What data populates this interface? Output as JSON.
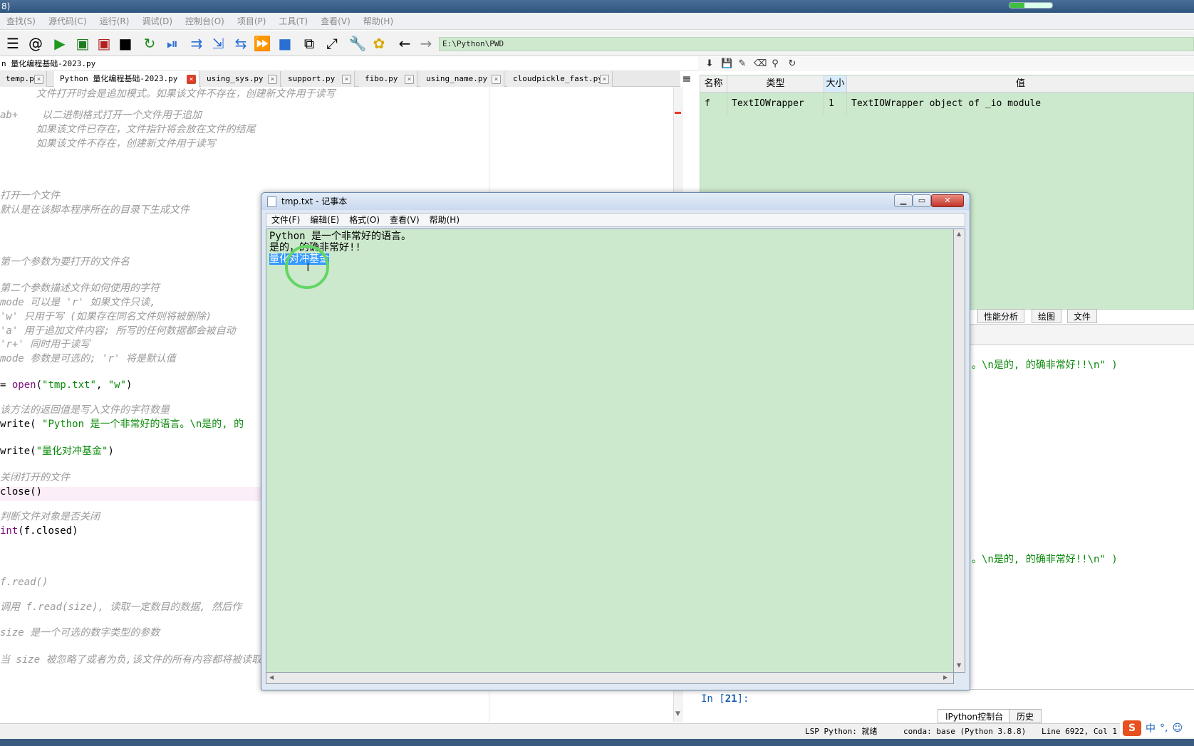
{
  "window": {
    "title_fragment": "8)"
  },
  "task_progress": 0.35,
  "menubar": [
    "查找(S)",
    "源代码(C)",
    "运行(R)",
    "调试(D)",
    "控制台(O)",
    "项目(P)",
    "工具(T)",
    "查看(V)",
    "帮助(H)"
  ],
  "toolbar": {
    "icons": [
      "outline-icon",
      "at-icon",
      "run-icon",
      "run-cell-icon",
      "run-cell-advance-icon",
      "run-selection-icon",
      "rerun-icon",
      "debug-icon",
      "step-icon",
      "step-into-icon",
      "step-return-icon",
      "continue-icon",
      "stop-icon",
      "maximize-pane-icon",
      "fullscreen-icon",
      "preferences-icon",
      "python-path-icon",
      "back-icon",
      "forward-icon"
    ],
    "path": "E:\\Python\\PWD"
  },
  "editor": {
    "file_title": "n 量化编程基础-2023.py",
    "tabs": [
      "temp.py",
      "Python 量化编程基础-2023.py",
      "using_sys.py",
      "support.py",
      "fibo.py",
      "using_name.py",
      "cloudpickle_fast.py"
    ],
    "active_tab": 1
  },
  "code_lines": [
    {
      "type": "cmt",
      "text": "      文件打开时会是追加模式。如果该文件不存在，创建新文件用于读写"
    },
    {
      "type": "cmt",
      "text": "ab+    以二进制格式打开一个文件用于追加"
    },
    {
      "type": "cmt",
      "text": "      如果该文件已存在，文件指针将会放在文件的结尾"
    },
    {
      "type": "cmt",
      "text": "      如果该文件不存在，创建新文件用于读写"
    },
    {
      "type": "cmt",
      "text": "打开一个文件"
    },
    {
      "type": "cmt",
      "text": "默认是在该脚本程序所在的目录下生成文件"
    },
    {
      "type": "cmt",
      "text": "第一个参数为要打开的文件名"
    },
    {
      "type": "cmt",
      "text": "第二个参数描述文件如何使用的字符"
    },
    {
      "type": "cmt",
      "text": "mode 可以是 'r' 如果文件只读,"
    },
    {
      "type": "cmt",
      "text": "'w' 只用于写 (如果存在同名文件则将被删除)"
    },
    {
      "type": "cmt",
      "text": "'a' 用于追加文件内容; 所写的任何数据都会被自动"
    },
    {
      "type": "cmt",
      "text": "'r+' 同时用于读写"
    },
    {
      "type": "cmt",
      "text": "mode 参数是可选的; 'r' 将是默认值"
    },
    {
      "type": "open",
      "pre": "= ",
      "fn": "open",
      "a": "(",
      "s1": "\"tmp.txt\"",
      "b": ", ",
      "s2": "\"w\"",
      "c": ")"
    },
    {
      "type": "cmt",
      "text": "该方法的返回值是写入文件的字符数量"
    },
    {
      "type": "write1",
      "pre": "write( ",
      "s": "\"Python 是一个非常好的语言。\\n是的, 的"
    },
    {
      "type": "write2",
      "pre": "write(",
      "s": "\"量化对冲基金\"",
      "c": ")"
    },
    {
      "type": "cmt",
      "text": "关闭打开的文件"
    },
    {
      "type": "plain",
      "text": "close()"
    },
    {
      "type": "cmt",
      "text": "判断文件对象是否关闭"
    },
    {
      "type": "print",
      "kw": "int",
      "text": "(f.closed)"
    },
    {
      "type": "cmt",
      "text": "f.read()"
    },
    {
      "type": "cmt",
      "text": "调用 f.read(size), 读取一定数目的数据, 然后作"
    },
    {
      "type": "cmt",
      "text": "size 是一个可选的数字类型的参数"
    },
    {
      "type": "cmt",
      "text": "当 size 被忽略了或者为负,该文件的所有内容都将被读取并且返回"
    }
  ],
  "variable_explorer": {
    "headers": [
      "名称",
      "类型",
      "大小",
      "值"
    ],
    "rows": [
      {
        "name": "f",
        "type": "TextIOWrapper",
        "size": "1",
        "value": "TextIOWrapper object of _io module"
      }
    ]
  },
  "right_tabs": [
    "性能分析",
    "绘图",
    "文件"
  ],
  "console": {
    "output1": "。\\n是的, 的确非常好!!\\n\" )",
    "output2": "。\\n是的, 的确非常好!!\\n\" )",
    "prompt_in": "In [",
    "prompt_num": "21",
    "prompt_end": "]:"
  },
  "bottom_tabs": [
    "IPython控制台",
    "历史"
  ],
  "statusbar": {
    "lsp": "LSP Python: 就绪",
    "conda": "conda: base (Python 3.8.8)",
    "position": "Line 6922, Col 1"
  },
  "ime": {
    "logo": "S",
    "lang": "中",
    "punct": "°,",
    "extra": "☺"
  },
  "notepad": {
    "title": "tmp.txt - 记事本",
    "menu": [
      "文件(F)",
      "编辑(E)",
      "格式(O)",
      "查看(V)",
      "帮助(H)"
    ],
    "lines": [
      "Python 是一个非常好的语言。",
      "是的，的确非常好!!",
      "量化对冲基金"
    ],
    "selected_line": 2
  },
  "colors": {
    "editor_bg": "#ffffff",
    "pane_green": "#cde9cd",
    "selection": "#3399ff",
    "string": "#0a8a0a",
    "keyword": "#7a0f7a",
    "comment": "#9a9a9a"
  }
}
